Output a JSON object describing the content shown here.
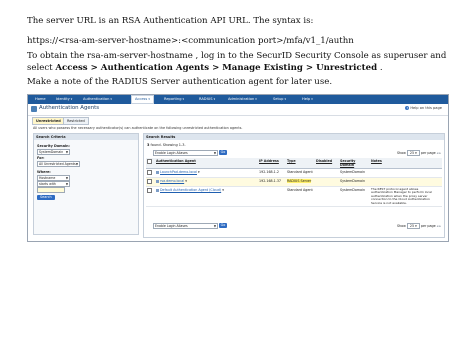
{
  "doc": {
    "p1": "The server URL is an RSA Authentication API URL. The syntax is:",
    "p2": "https://<rsa-am-server-hostname>:<communication port>/mfa/v1_1/authn",
    "p3_a": "To obtain the rsa-am-server-hostname , log in to the SecurID Security Console as superuser and select ",
    "p3_b": "Access > Authentication Agents > Manage Existing > Unrestricted",
    "p3_c": " .",
    "p4": "Make a note of the RADIUS Server authentication agent for later use."
  },
  "console": {
    "nav": [
      {
        "label": "Home",
        "active": false
      },
      {
        "label": "Identity",
        "active": false
      },
      {
        "label": "Authentication",
        "active": false
      },
      {
        "label": "Access",
        "active": true
      },
      {
        "label": "Reporting",
        "active": false
      },
      {
        "label": "RADIUS",
        "active": false
      },
      {
        "label": "Administration",
        "active": false
      },
      {
        "label": "Setup",
        "active": false
      },
      {
        "label": "Help",
        "active": false
      }
    ],
    "page_title": "Authentication Agents",
    "help_link": "Help on this page",
    "tabs": [
      "Unrestricted",
      "Restricted"
    ],
    "intro": "All users who possess the necessary authenticator(s) can authenticate on the following unrestricted authentication agents.",
    "criteria": {
      "title": "Search Criteria",
      "security_domain_label": "Security Domain:",
      "security_domain_value": "SystemDomain",
      "for_label": "For:",
      "for_value": "All Unrestricted Agents",
      "where_label": "Where:",
      "where_field": "Hostname",
      "where_op": "starts with",
      "search_button": "Search"
    },
    "results": {
      "title": "Search Results",
      "found_count": "3",
      "found_text": " found. Showing 1-3.",
      "bulk_action": "Enable Login Aliases",
      "go_button": "Go",
      "pager_show": "Show",
      "pager_size": "25",
      "pager_suffix": "per page",
      "columns": [
        "Authentication Agent",
        "IP Address",
        "Type",
        "Disabled",
        "Security Domain",
        "Notes"
      ],
      "rows": [
        {
          "name": "LaunchPad.demo.local",
          "ip": "192.168.1.2",
          "type": "Standard Agent",
          "disabled": "",
          "domain": "SystemDomain",
          "notes": "",
          "highlight": false
        },
        {
          "name": "rsa.demo.local",
          "ip": "192.168.1.37",
          "type": "RADIUS Server",
          "disabled": "",
          "domain": "SystemDomain",
          "notes": "",
          "highlight": true
        },
        {
          "name": "Default Authentication Agent (Cloud)",
          "ip": "",
          "type": "Standard Agent",
          "disabled": "",
          "domain": "SystemDomain",
          "notes": "The REST protocol agent allows authentication Manager to perform local authentication when the proxy server connection to the Cloud Authentication Service is not available.",
          "highlight": false
        }
      ]
    }
  }
}
